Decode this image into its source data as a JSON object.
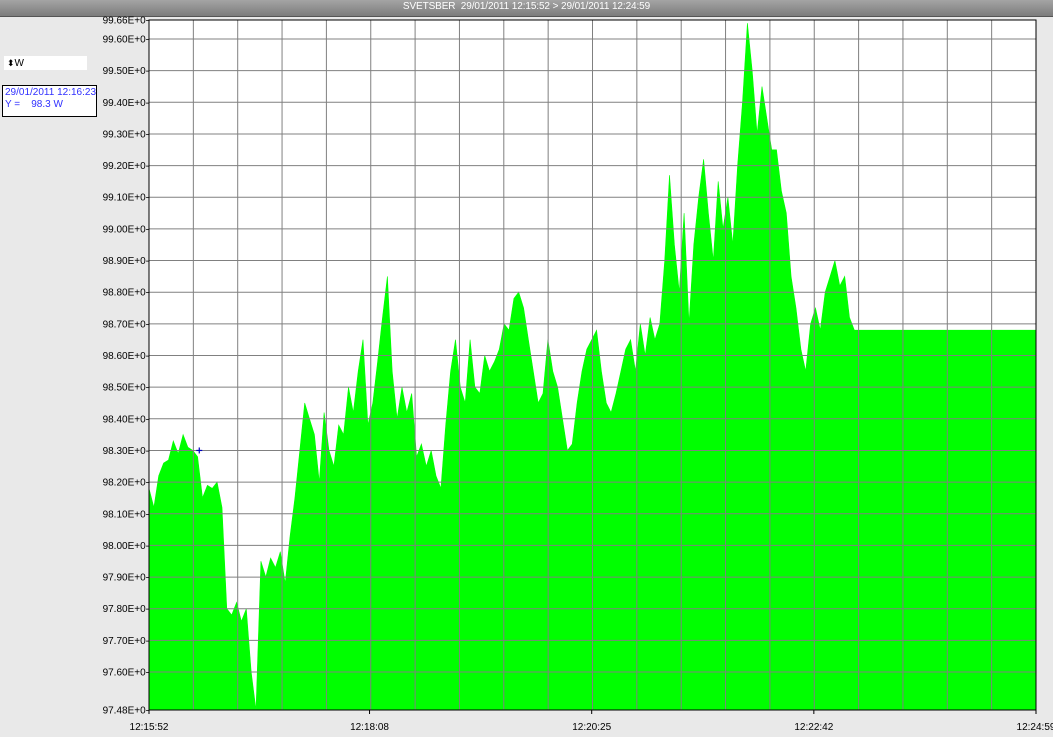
{
  "window": {
    "title": "SVETSBER  29/01/2011 12:15:52 > 29/01/2011 12:24:59"
  },
  "unit_selector": {
    "value": "W",
    "icon": "up-down-arrows-icon"
  },
  "cursor_readout": {
    "datetime": "29/01/2011 12:16:23",
    "value_line": "Y =    98.3 W"
  },
  "colors": {
    "series_fill": "#00ff00",
    "grid": "#808080",
    "plot_bg": "#ffffff",
    "cursor_marker": "#0000c0"
  },
  "chart_data": {
    "type": "area",
    "title": "SVETSBER  29/01/2011 12:15:52 > 29/01/2011 12:24:59",
    "xlabel": "",
    "ylabel": "",
    "unit": "W",
    "grid": true,
    "xlim": [
      "12:15:52",
      "12:24:59"
    ],
    "ylim": [
      97.48,
      99.66
    ],
    "x_tick_labels": [
      "12:15:52",
      "12:18:08",
      "12:20:25",
      "12:22:42",
      "12:24:59"
    ],
    "y_tick_labels": [
      "99.66E+0-",
      "99.60E+0-",
      "99.50E+0-",
      "99.40E+0-",
      "99.30E+0-",
      "99.20E+0-",
      "99.10E+0-",
      "99.00E+0-",
      "98.90E+0-",
      "98.80E+0-",
      "98.70E+0-",
      "98.60E+0-",
      "98.50E+0-",
      "98.40E+0-",
      "98.30E+0-",
      "98.20E+0-",
      "98.10E+0-",
      "98.00E+0-",
      "97.90E+0-",
      "97.80E+0-",
      "97.70E+0-",
      "97.60E+0-",
      "97.48E+0-"
    ],
    "series": [
      {
        "values_time": [
          "12:15:52",
          "12:15:55",
          "12:15:58",
          "12:16:01",
          "12:16:04",
          "12:16:07",
          "12:16:10",
          "12:16:13",
          "12:16:16",
          "12:16:19",
          "12:16:22",
          "12:16:25",
          "12:16:28",
          "12:16:31",
          "12:16:34",
          "12:16:37",
          "12:16:40",
          "12:16:43",
          "12:16:46",
          "12:16:49",
          "12:16:52",
          "12:16:55",
          "12:16:58",
          "12:17:01",
          "12:17:04",
          "12:17:07",
          "12:17:10",
          "12:17:13",
          "12:17:16",
          "12:17:19",
          "12:17:22",
          "12:17:25",
          "12:17:28",
          "12:17:31",
          "12:17:34",
          "12:17:37",
          "12:17:40",
          "12:17:43",
          "12:17:46",
          "12:17:49",
          "12:17:52",
          "12:17:55",
          "12:17:58",
          "12:18:01",
          "12:18:04",
          "12:18:07",
          "12:18:10",
          "12:18:13",
          "12:18:16",
          "12:18:19",
          "12:18:22",
          "12:18:25",
          "12:18:28",
          "12:18:31",
          "12:18:34",
          "12:18:37",
          "12:18:40",
          "12:18:43",
          "12:18:46",
          "12:18:49",
          "12:18:52",
          "12:18:55",
          "12:18:58",
          "12:19:01",
          "12:19:04",
          "12:19:07",
          "12:19:10",
          "12:19:13",
          "12:19:16",
          "12:19:19",
          "12:19:22",
          "12:19:25",
          "12:19:28",
          "12:19:31",
          "12:19:34",
          "12:19:37",
          "12:19:40",
          "12:19:43",
          "12:19:46",
          "12:19:49",
          "12:19:52",
          "12:19:55",
          "12:19:58",
          "12:20:01",
          "12:20:04",
          "12:20:07",
          "12:20:10",
          "12:20:13",
          "12:20:16",
          "12:20:19",
          "12:20:22",
          "12:20:25",
          "12:20:28",
          "12:20:31",
          "12:20:34",
          "12:20:37",
          "12:20:40",
          "12:20:43",
          "12:20:46",
          "12:20:49",
          "12:20:52",
          "12:20:55",
          "12:20:58",
          "12:21:01",
          "12:21:04",
          "12:21:07",
          "12:21:10",
          "12:21:13",
          "12:21:16",
          "12:21:19",
          "12:21:22",
          "12:21:25",
          "12:21:28",
          "12:21:31",
          "12:21:34",
          "12:21:37",
          "12:21:40",
          "12:21:43",
          "12:21:46",
          "12:21:49",
          "12:21:52",
          "12:21:55",
          "12:21:58",
          "12:22:01",
          "12:22:04",
          "12:22:07",
          "12:22:10",
          "12:22:13",
          "12:22:16",
          "12:22:19",
          "12:22:22",
          "12:22:25",
          "12:22:28",
          "12:22:31",
          "12:22:34",
          "12:22:37",
          "12:22:40",
          "12:22:43",
          "12:22:46",
          "12:22:49",
          "12:22:52",
          "12:22:55",
          "12:22:58",
          "12:23:01",
          "12:23:04",
          "12:23:07",
          "12:23:10",
          "12:23:13",
          "12:23:16",
          "12:23:19",
          "12:23:22",
          "12:23:25",
          "12:23:28",
          "12:23:31",
          "12:23:34",
          "12:23:37",
          "12:23:40",
          "12:23:43",
          "12:23:46",
          "12:23:49",
          "12:23:52",
          "12:23:55",
          "12:23:58",
          "12:24:01",
          "12:24:04",
          "12:24:07",
          "12:24:10",
          "12:24:13",
          "12:24:16",
          "12:24:19",
          "12:24:22",
          "12:24:25",
          "12:24:28",
          "12:24:31",
          "12:24:34",
          "12:24:37",
          "12:24:40",
          "12:24:43",
          "12:24:46",
          "12:24:49",
          "12:24:52",
          "12:24:55",
          "12:24:58"
        ],
        "values": [
          98.18,
          98.12,
          98.22,
          98.26,
          98.27,
          98.33,
          98.29,
          98.35,
          98.31,
          98.3,
          98.28,
          98.15,
          98.19,
          98.18,
          98.2,
          98.12,
          97.8,
          97.78,
          97.82,
          97.76,
          97.8,
          97.6,
          97.48,
          97.95,
          97.9,
          97.96,
          97.93,
          97.98,
          97.88,
          98.03,
          98.15,
          98.3,
          98.45,
          98.4,
          98.35,
          98.2,
          98.42,
          98.3,
          98.25,
          98.38,
          98.35,
          98.5,
          98.42,
          98.55,
          98.65,
          98.38,
          98.45,
          98.58,
          98.72,
          98.85,
          98.55,
          98.4,
          98.5,
          98.42,
          98.48,
          98.28,
          98.32,
          98.25,
          98.3,
          98.22,
          98.18,
          98.38,
          98.55,
          98.65,
          98.5,
          98.45,
          98.65,
          98.5,
          98.48,
          98.6,
          98.55,
          98.58,
          98.62,
          98.7,
          98.68,
          98.78,
          98.8,
          98.75,
          98.65,
          98.55,
          98.45,
          98.48,
          98.65,
          98.55,
          98.5,
          98.4,
          98.3,
          98.32,
          98.45,
          98.55,
          98.62,
          98.65,
          98.68,
          98.55,
          98.45,
          98.42,
          98.48,
          98.55,
          98.62,
          98.65,
          98.55,
          98.7,
          98.6,
          98.72,
          98.65,
          98.7,
          98.9,
          99.17,
          98.95,
          98.8,
          99.05,
          98.7,
          98.95,
          99.1,
          99.22,
          99.05,
          98.9,
          99.15,
          99.0,
          99.1,
          98.95,
          99.2,
          99.4,
          99.65,
          99.5,
          99.3,
          99.45,
          99.35,
          99.25,
          99.25,
          99.12,
          99.05,
          98.85,
          98.75,
          98.62,
          98.55,
          98.7,
          98.75,
          98.68,
          98.8,
          98.85,
          98.9,
          98.82,
          98.85,
          98.72,
          98.68
        ],
        "marker": {
          "x": "12:16:23",
          "y": 98.3
        }
      }
    ]
  }
}
